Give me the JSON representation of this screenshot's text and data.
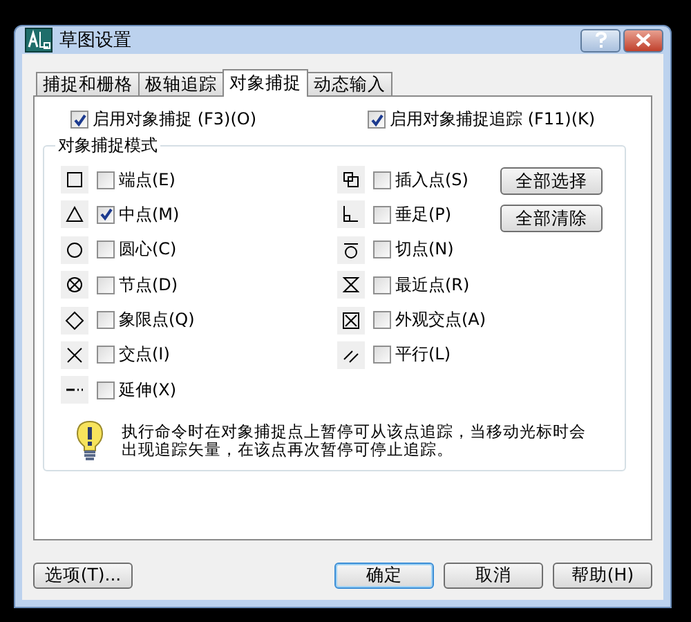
{
  "window": {
    "title": "草图设置"
  },
  "tabs": [
    {
      "label": "捕捉和栅格",
      "selected": false
    },
    {
      "label": "极轴追踪",
      "selected": false
    },
    {
      "label": "对象捕捉",
      "selected": true
    },
    {
      "label": "动态输入",
      "selected": false
    }
  ],
  "options": [
    {
      "label": "启用对象捕捉 (F3)(O)",
      "checked": true
    },
    {
      "label": "启用对象捕捉追踪 (F11)(K)",
      "checked": true
    }
  ],
  "group": {
    "title": "对象捕捉模式",
    "columns": [
      {
        "modes": [
          {
            "label": "端点(E)",
            "checked": false
          },
          {
            "label": "中点(M)",
            "checked": true
          },
          {
            "label": "圆心(C)",
            "checked": false
          },
          {
            "label": "节点(D)",
            "checked": false
          },
          {
            "label": "象限点(Q)",
            "checked": false
          },
          {
            "label": "交点(I)",
            "checked": false
          },
          {
            "label": "延伸(X)",
            "checked": false
          }
        ]
      },
      {
        "modes": [
          {
            "label": "插入点(S)",
            "checked": false
          },
          {
            "label": "垂足(P)",
            "checked": false
          },
          {
            "label": "切点(N)",
            "checked": false
          },
          {
            "label": "最近点(R)",
            "checked": false
          },
          {
            "label": "外观交点(A)",
            "checked": false
          },
          {
            "label": "平行(L)",
            "checked": false
          }
        ]
      }
    ],
    "buttons": [
      "全部选择",
      "全部清除"
    ],
    "hint": "执行命令时在对象捕捉点上暂停可从该点追踪，当移动光标时会出现追踪矢量，在该点再次暂停可停止追踪。"
  },
  "footer": [
    {
      "label": "选项(T)...",
      "default": false
    },
    {
      "label": "确定",
      "default": true
    },
    {
      "label": "取消",
      "default": false
    },
    {
      "label": "帮助(H)",
      "default": false
    }
  ]
}
